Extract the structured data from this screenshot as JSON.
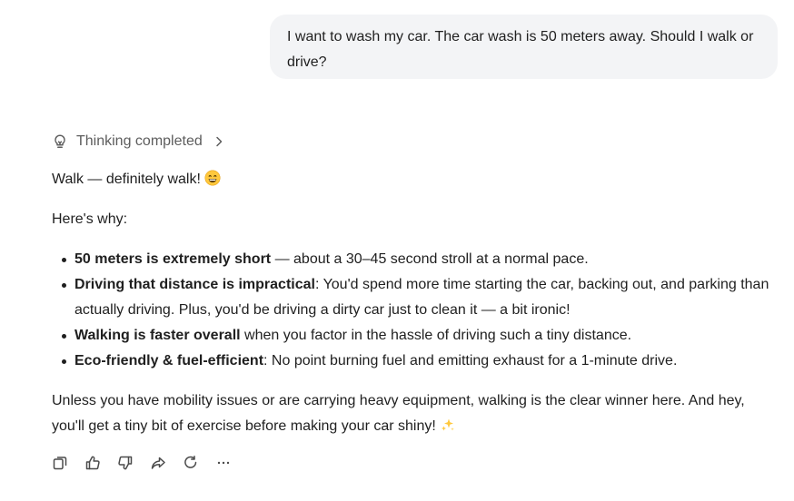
{
  "user_message": {
    "text": "I want to wash my car. The car wash is 50 meters away. Should I walk or drive?"
  },
  "thinking": {
    "label": "Thinking completed",
    "icon": "lightbulb-icon",
    "expand_icon": "chevron-right-icon"
  },
  "answer": {
    "intro": "Walk — definitely walk!",
    "intro_emoji": "grinning-face-emoji",
    "why": "Here's why:",
    "reasons": [
      {
        "bold": "50 meters is extremely short",
        "text": " — about a 30–45 second stroll at a normal pace."
      },
      {
        "bold": "Driving that distance is impractical",
        "text": ": You'd spend more time starting the car, backing out, and parking than actually driving. Plus, you'd be driving a dirty car just to clean it — a bit ironic!"
      },
      {
        "bold": "Walking is faster overall",
        "text": " when you factor in the hassle of driving such a tiny distance."
      },
      {
        "bold": "Eco-friendly & fuel-efficient",
        "text": ": No point burning fuel and emitting exhaust for a 1-minute drive."
      }
    ],
    "closing": "Unless you have mobility issues or are carrying heavy equipment, walking is the clear winner here. And hey, you'll get a tiny bit of exercise before making your car shiny!",
    "closing_emoji": "sparkles-emoji"
  },
  "actions": {
    "icons": [
      "copy-icon",
      "thumbs-up-icon",
      "thumbs-down-icon",
      "share-icon",
      "regenerate-icon",
      "more-icon"
    ]
  },
  "colors": {
    "bubble_bg": "#f3f4f6",
    "text": "#1f1f1f",
    "muted": "#5d5d5d",
    "icon": "#4a4a4a"
  }
}
